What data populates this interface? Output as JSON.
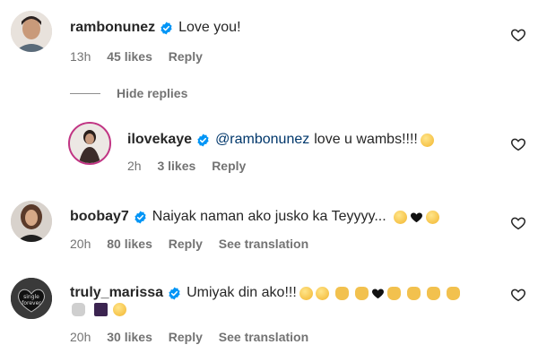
{
  "comments": [
    {
      "username": "rambonunez",
      "verified": true,
      "text": "Love you!",
      "time": "13h",
      "likes": "45 likes",
      "reply": "Reply"
    },
    {
      "username": "ilovekaye",
      "verified": true,
      "mention": "@rambonunez",
      "text": "love u wambs!!!!",
      "time": "2h",
      "likes": "3 likes",
      "reply": "Reply"
    },
    {
      "username": "boobay7",
      "verified": true,
      "text": "Naiyak naman ako jusko ka Teyyyy...",
      "time": "20h",
      "likes": "80 likes",
      "reply": "Reply",
      "see_translation": "See translation"
    },
    {
      "username": "truly_marissa",
      "verified": true,
      "text": "Umiyak din ako!!!",
      "time": "20h",
      "likes": "30 likes",
      "reply": "Reply",
      "see_translation": "See translation",
      "avatar_text": "single forever"
    }
  ],
  "thread": {
    "hide_replies": "Hide replies"
  },
  "icons": {
    "verified": "verified-badge-icon",
    "like": "heart-outline-icon"
  },
  "colors": {
    "verified_blue": "#0095f6",
    "mention": "#00376b",
    "meta_gray": "#737373"
  }
}
